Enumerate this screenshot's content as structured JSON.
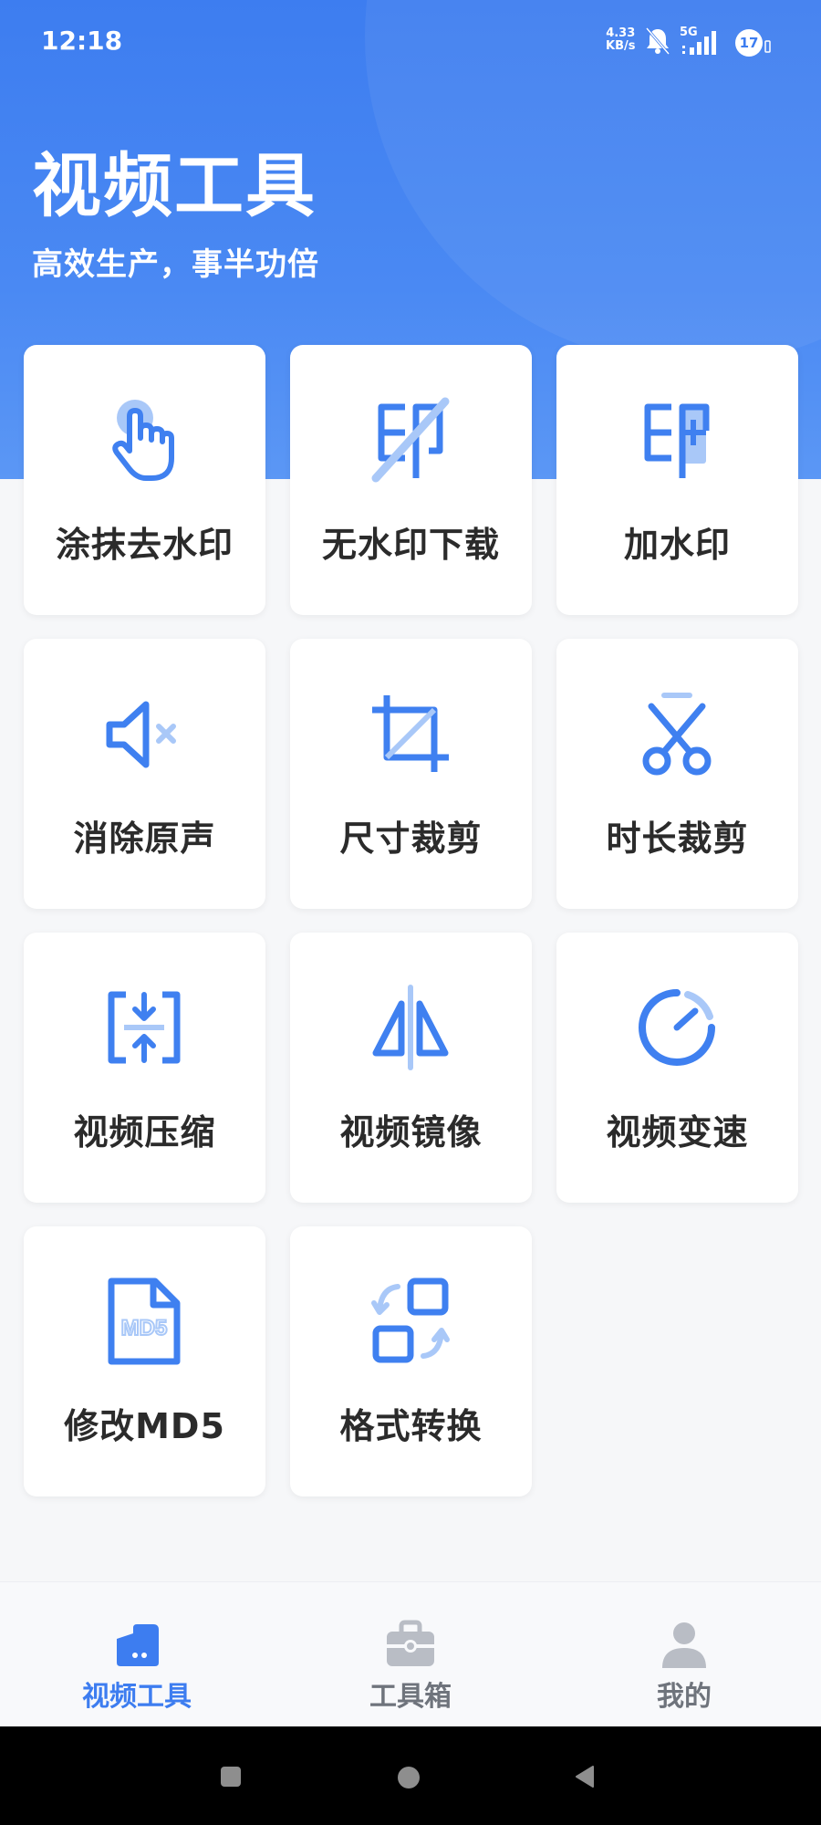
{
  "status_bar": {
    "time": "12:18",
    "net_speed_value": "4.33",
    "net_speed_unit": "KB/s",
    "network": "5G",
    "notification_count": "17"
  },
  "header": {
    "title": "视频工具",
    "subtitle": "高效生产，事半功倍"
  },
  "tools": [
    {
      "label": "涂抹去水印",
      "icon": "tap-hand-icon"
    },
    {
      "label": "无水印下载",
      "icon": "no-watermark-icon"
    },
    {
      "label": "加水印",
      "icon": "add-watermark-icon"
    },
    {
      "label": "消除原声",
      "icon": "mute-icon"
    },
    {
      "label": "尺寸裁剪",
      "icon": "crop-icon"
    },
    {
      "label": "时长裁剪",
      "icon": "scissors-icon"
    },
    {
      "label": "视频压缩",
      "icon": "compress-icon"
    },
    {
      "label": "视频镜像",
      "icon": "mirror-icon"
    },
    {
      "label": "视频变速",
      "icon": "speed-gauge-icon"
    },
    {
      "label": "修改MD5",
      "icon": "md5-file-icon"
    },
    {
      "label": "格式转换",
      "icon": "convert-icon"
    }
  ],
  "bottom_nav": [
    {
      "label": "视频工具",
      "icon": "video-camera-icon",
      "active": true
    },
    {
      "label": "工具箱",
      "icon": "toolbox-icon",
      "active": false
    },
    {
      "label": "我的",
      "icon": "person-icon",
      "active": false
    }
  ],
  "colors": {
    "primary": "#3d7df0",
    "icon_blue": "#3f80f0",
    "icon_light_blue": "#a9c8f8",
    "inactive": "#8a8f99"
  }
}
